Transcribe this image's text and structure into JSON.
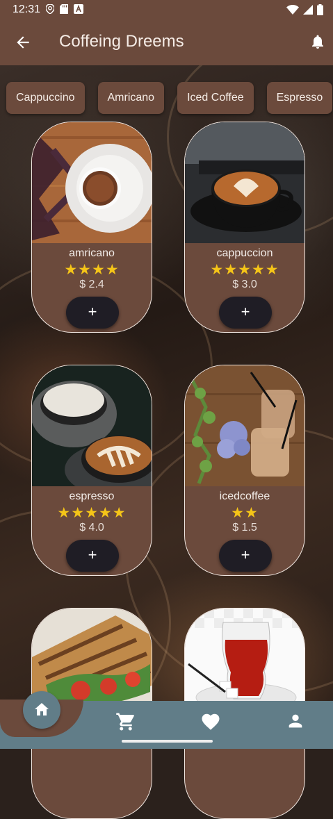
{
  "status_bar": {
    "time": "12:31"
  },
  "app_bar": {
    "title": "Coffeing Dreems"
  },
  "categories": [
    "Cappuccino",
    "Amricano",
    "Iced Coffee",
    "Espresso"
  ],
  "products": [
    {
      "name": "amricano",
      "stars": "★★★★",
      "rating": 4,
      "price": "$ 2.4"
    },
    {
      "name": "cappuccion",
      "stars": "★★★★★",
      "rating": 5,
      "price": "$ 3.0"
    },
    {
      "name": "espresso",
      "stars": "★★★★★",
      "rating": 5,
      "price": "$ 4.0"
    },
    {
      "name": "icedcoffee",
      "stars": "★★",
      "rating": 2,
      "price": "$ 1.5"
    },
    {
      "name": "",
      "stars": "",
      "price": ""
    },
    {
      "name": "",
      "stars": "",
      "price": ""
    }
  ],
  "add_label": "+",
  "colors": {
    "primary": "#6b4a3c",
    "nav": "#617d88",
    "star": "#f5c518",
    "button": "#1f1d25"
  },
  "nav": {
    "items": [
      "home-icon",
      "cart-icon",
      "heart-icon",
      "user-icon"
    ]
  }
}
